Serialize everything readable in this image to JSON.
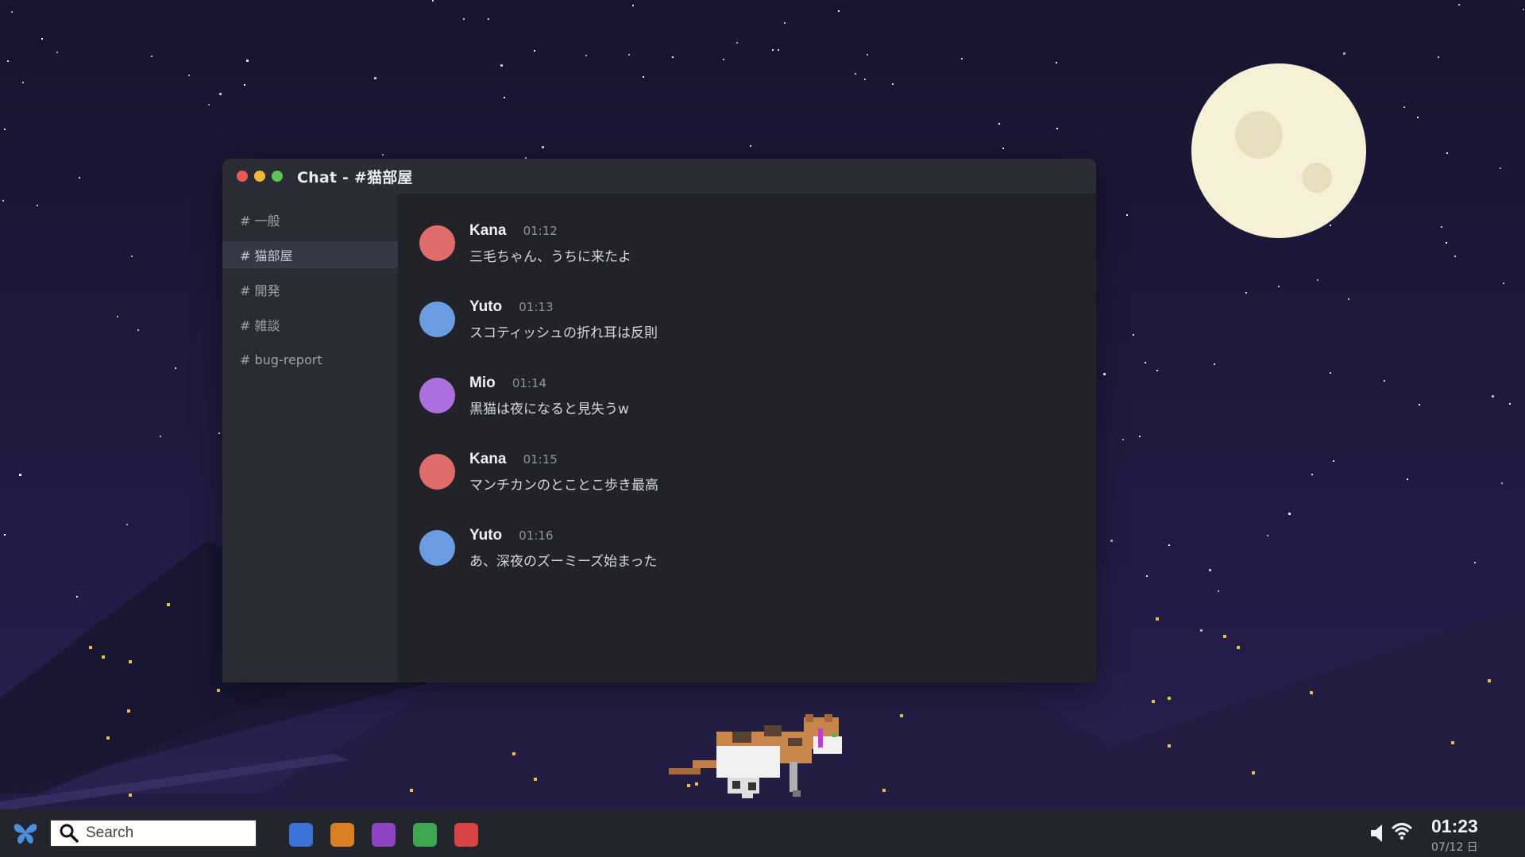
{
  "window": {
    "title": "Chat - #猫部屋",
    "traffic_lights": [
      "#ec5a55",
      "#f2b83b",
      "#5fc454"
    ]
  },
  "sidebar": {
    "channels": [
      {
        "label": "# 一般",
        "active": false
      },
      {
        "label": "# 猫部屋",
        "active": true
      },
      {
        "label": "# 開発",
        "active": false
      },
      {
        "label": "# 雑談",
        "active": false
      },
      {
        "label": "# bug-report",
        "active": false
      }
    ]
  },
  "messages": [
    {
      "user": "Kana",
      "time": "01:12",
      "text": "三毛ちゃん、うちに来たよ",
      "avatar_color": "#e06b6b"
    },
    {
      "user": "Yuto",
      "time": "01:13",
      "text": "スコティッシュの折れ耳は反則",
      "avatar_color": "#6b9be0"
    },
    {
      "user": "Mio",
      "time": "01:14",
      "text": "黒猫は夜になると見失うw",
      "avatar_color": "#ac6fdd"
    },
    {
      "user": "Kana",
      "time": "01:15",
      "text": "マンチカンのとことこ歩き最高",
      "avatar_color": "#e06b6b"
    },
    {
      "user": "Yuto",
      "time": "01:16",
      "text": "あ、深夜のズーミーズ始まった",
      "avatar_color": "#6b9be0"
    }
  ],
  "taskbar": {
    "start_icon": "butterfly-icon",
    "search_placeholder": "Search",
    "apps": [
      {
        "name": "app-blue",
        "color": "#3b73d6"
      },
      {
        "name": "app-orange",
        "color": "#db7f24"
      },
      {
        "name": "app-purple",
        "color": "#8e44c4"
      },
      {
        "name": "app-green",
        "color": "#3fa652"
      },
      {
        "name": "app-red",
        "color": "#d84444"
      }
    ],
    "tray": [
      "volume-icon",
      "wifi-icon"
    ],
    "clock_time": "01:23",
    "clock_date": "07/12 日"
  },
  "scene": {
    "sky_color": "#1b1733",
    "moon_color": "#f6f1d6",
    "mountain_color": "#1f1a3a",
    "ground_color": "#241e45"
  }
}
